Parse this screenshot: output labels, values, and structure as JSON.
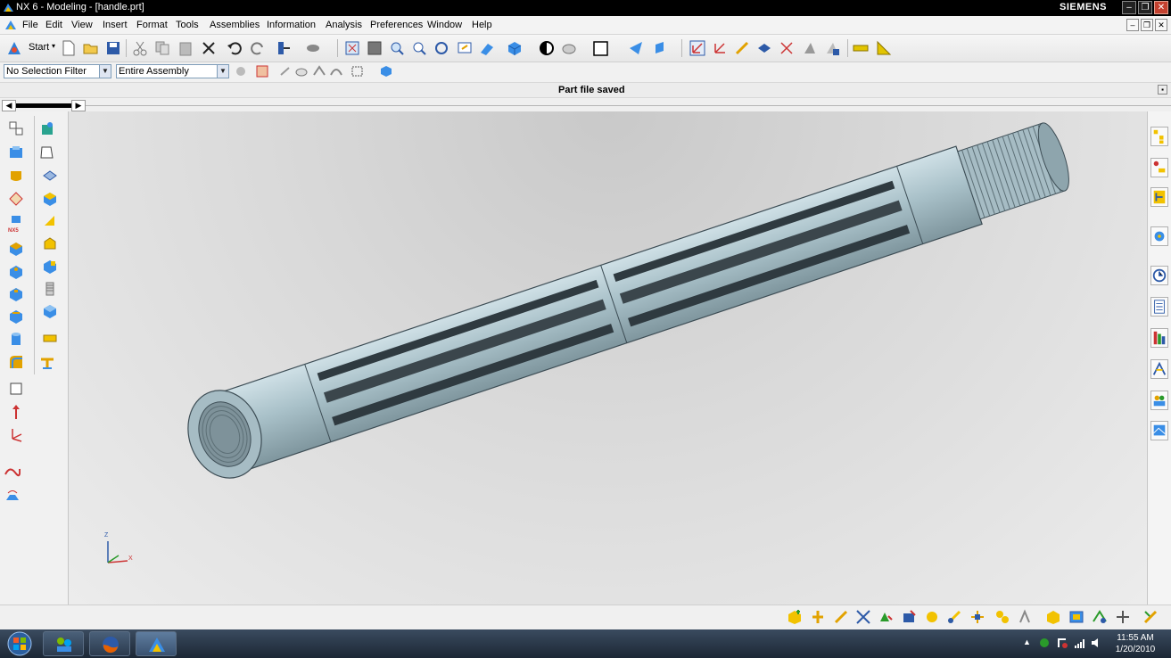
{
  "window": {
    "title": "NX 6 - Modeling - [handle.prt]",
    "brand": "SIEMENS"
  },
  "menubar": {
    "items": [
      "File",
      "Edit",
      "View",
      "Insert",
      "Format",
      "Tools",
      "Assemblies",
      "Information",
      "Analysis",
      "Preferences",
      "Window",
      "Help"
    ]
  },
  "toolbar": {
    "start_label": "Start"
  },
  "selection": {
    "filter_value": "No Selection Filter",
    "scope_value": "Entire Assembly"
  },
  "status": {
    "message": "Part file saved"
  },
  "left_palette": {
    "nx5_label": "NX5"
  },
  "triad": {
    "z": "Z",
    "x": "X"
  },
  "taskbar": {
    "time": "11:55 AM",
    "date": "1/20/2010"
  },
  "colors": {
    "titlebar": "#000000",
    "model": "#9fb6bf",
    "viewport": "#dcdcdc",
    "taskbar": "#1c2735"
  }
}
